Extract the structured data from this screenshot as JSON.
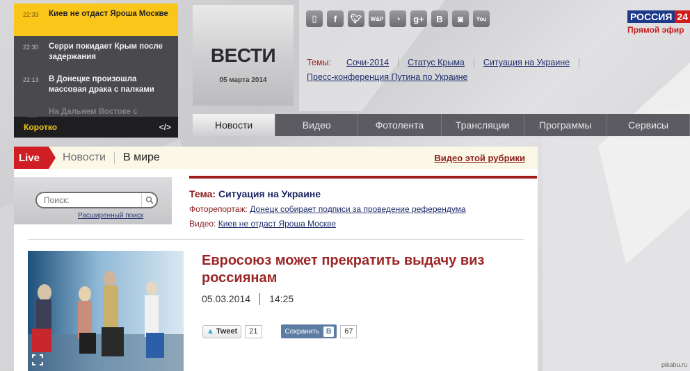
{
  "ticker": {
    "items": [
      {
        "time": "22:33",
        "text": "Киев не отдаст Яроша Москве",
        "active": true
      },
      {
        "time": "22:30",
        "text": "Серри покидает Крым после задержания",
        "active": false
      },
      {
        "time": "22:13",
        "text": "В Донецке произошла массовая драка с палками",
        "active": false
      },
      {
        "time": "",
        "text": "На Дальнем Востоке с",
        "active": false
      }
    ],
    "footer_label": "Коротко",
    "footer_icon": "</>"
  },
  "logo": {
    "word": "ВЕСТИ",
    "date": "05 марта 2014"
  },
  "socials": [
    "phone-icon",
    "facebook-icon",
    "twitter-icon",
    "wap-icon",
    "rss-icon",
    "google-plus-icon",
    "vkontakte-icon",
    "instagram-icon",
    "youtube-icon"
  ],
  "social_glyphs": {
    "wap": "W&P",
    "youtube": "You",
    "vk": "B",
    "gplus": "g+",
    "fb": "f"
  },
  "brand": {
    "name": "РОССИЯ",
    "num": "24",
    "live": "Прямой эфир"
  },
  "topics": {
    "label": "Темы:",
    "links": [
      "Сочи-2014",
      "Статус Крыма",
      "Ситуация на Украине"
    ],
    "link2": "Пресс-конференция Путина по Украине"
  },
  "nav": [
    "Новости",
    "Видео",
    "Фотолента",
    "Трансляции",
    "Программы",
    "Сервисы"
  ],
  "section": {
    "live": "Live",
    "news": "Новости",
    "world": "В мире",
    "video_rubric": "Видео этой рубрики"
  },
  "search": {
    "placeholder": "Поиск:",
    "advanced": "Расширенный поиск"
  },
  "topic_block": {
    "tema_label": "Тема:",
    "tema_value": "Ситуация на Украине",
    "photo_label": "Фоторепортаж:",
    "photo_link": "Донецк собирает подписи за проведение референдума",
    "video_label": "Видео:",
    "video_link": "Киев не отдаст Яроша Москве"
  },
  "article": {
    "headline": "Евросоюз может прекратить выдачу виз россиянам",
    "date": "05.03.2014",
    "time": "14:25",
    "tweet_label": "Tweet",
    "tweet_count": "21",
    "vk_label": "Сохранить",
    "vk_count": "67"
  },
  "watermark": "pikabu.ru",
  "colors": {
    "accent": "#9c2626",
    "ticker_active": "#fbc61a",
    "nav_bg": "#5b5b61",
    "live": "#cf1f24"
  }
}
